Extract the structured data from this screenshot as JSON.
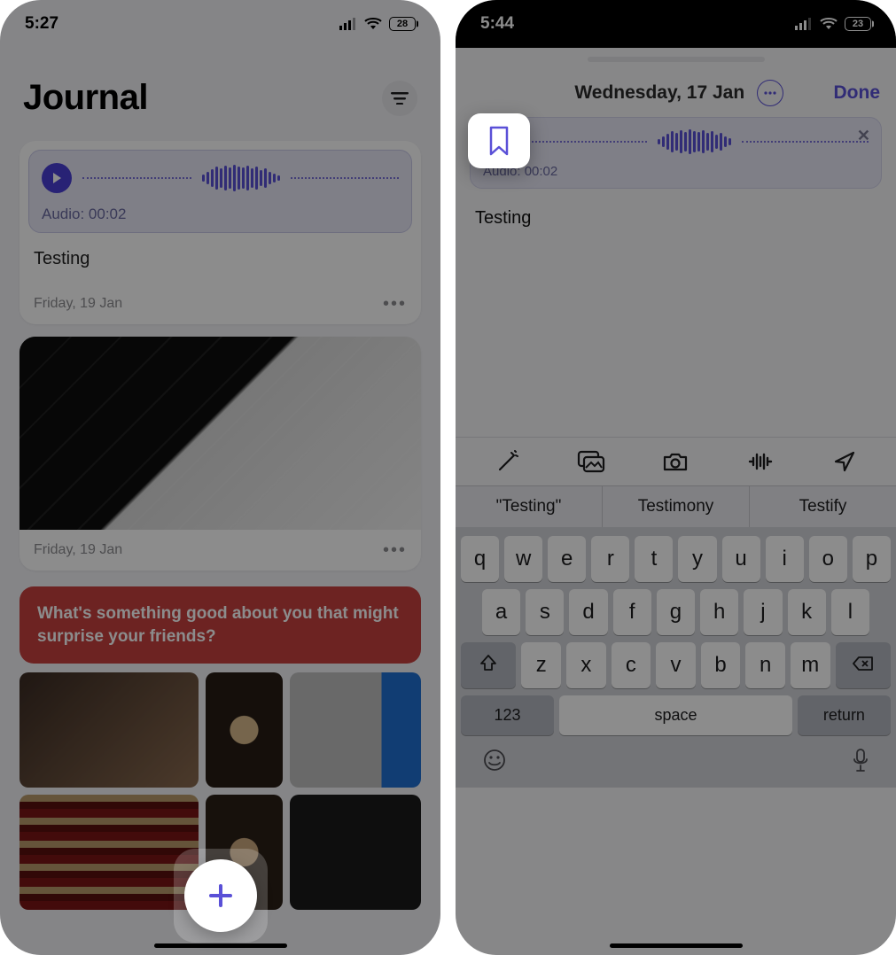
{
  "left": {
    "status": {
      "time": "5:27",
      "battery": "28"
    },
    "title": "Journal",
    "entry1": {
      "audio_label": "Audio: 00:02",
      "title": "Testing",
      "date": "Friday, 19 Jan"
    },
    "entry2": {
      "date": "Friday, 19 Jan"
    },
    "prompt": "What's something good about you that might surprise your friends?"
  },
  "right": {
    "status": {
      "time": "5:44",
      "battery": "23"
    },
    "header": {
      "date": "Wednesday, 17 Jan",
      "done": "Done"
    },
    "audio_label": "Audio: 00:02",
    "content": "Testing",
    "suggestions": [
      "\"Testing\"",
      "Testimony",
      "Testify"
    ],
    "keyboard": {
      "row1": [
        "q",
        "w",
        "e",
        "r",
        "t",
        "y",
        "u",
        "i",
        "o",
        "p"
      ],
      "row2": [
        "a",
        "s",
        "d",
        "f",
        "g",
        "h",
        "j",
        "k",
        "l"
      ],
      "row3": [
        "z",
        "x",
        "c",
        "v",
        "b",
        "n",
        "m"
      ],
      "num": "123",
      "space": "space",
      "ret": "return"
    }
  }
}
